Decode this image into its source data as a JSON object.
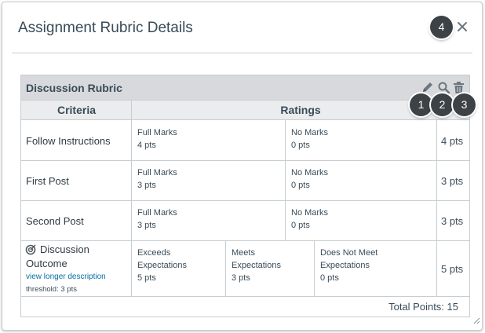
{
  "dialog": {
    "title": "Assignment Rubric Details"
  },
  "callouts": [
    "1",
    "2",
    "3",
    "4"
  ],
  "rubric": {
    "name": "Discussion Rubric",
    "headers": {
      "criteria": "Criteria",
      "ratings": "Ratings"
    },
    "rows": [
      {
        "name": "Follow Instructions",
        "ratings": [
          {
            "title": "Full Marks",
            "points": "4 pts"
          },
          {
            "title": "No Marks",
            "points": "0 pts"
          }
        ],
        "points": "4 pts"
      },
      {
        "name": "First Post",
        "ratings": [
          {
            "title": "Full Marks",
            "points": "3 pts"
          },
          {
            "title": "No Marks",
            "points": "0 pts"
          }
        ],
        "points": "3 pts"
      },
      {
        "name": "Second Post",
        "ratings": [
          {
            "title": "Full Marks",
            "points": "3 pts"
          },
          {
            "title": "No Marks",
            "points": "0 pts"
          }
        ],
        "points": "3 pts"
      },
      {
        "name_line1": "Discussion",
        "name_line2": "Outcome",
        "link": "view longer description",
        "threshold": "threshold: 3 pts",
        "ratings": [
          {
            "title_line1": "Exceeds",
            "title_line2": "Expectations",
            "points": "5 pts"
          },
          {
            "title_line1": "Meets",
            "title_line2": "Expectations",
            "points": "3 pts"
          },
          {
            "title_line1": "Does Not Meet",
            "title_line2": "Expectations",
            "points": "0 pts"
          }
        ],
        "points": "5 pts"
      }
    ],
    "total": "Total Points: 15"
  },
  "icons": [
    "pencil-icon",
    "search-icon",
    "trash-icon",
    "close-icon",
    "outcome-target-icon",
    "resize-grip-icon"
  ],
  "colors": {
    "header_bg": "#d8d9dc",
    "subheader_bg": "#ebeced",
    "border": "#c7cdd1",
    "link": "#0770a3",
    "callout": "#3d4246"
  }
}
